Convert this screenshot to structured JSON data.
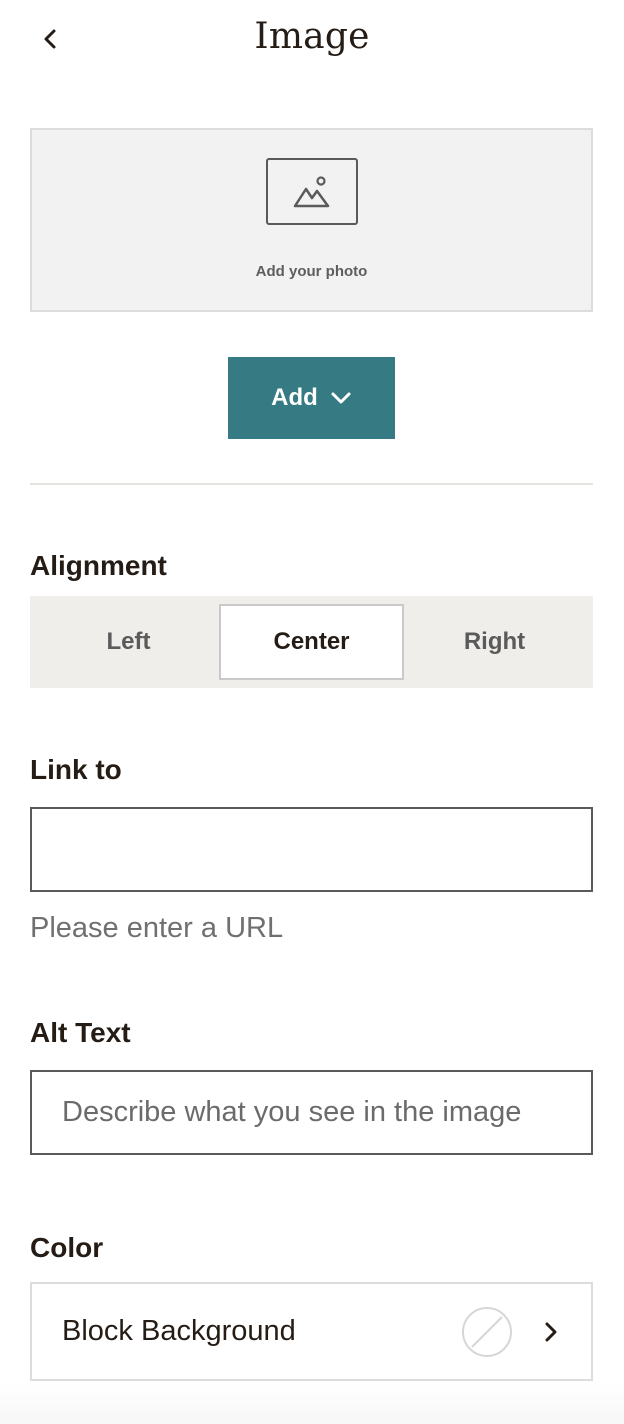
{
  "header": {
    "title": "Image",
    "back_icon": "chevron-left-icon"
  },
  "photo": {
    "icon": "image-icon",
    "label": "Add your photo"
  },
  "add_button": {
    "label": "Add",
    "icon": "chevron-down-icon"
  },
  "alignment": {
    "label": "Alignment",
    "options": [
      "Left",
      "Center",
      "Right"
    ],
    "selected": "Center"
  },
  "link": {
    "label": "Link to",
    "value": "",
    "helper": "Please enter a URL"
  },
  "alt_text": {
    "label": "Alt Text",
    "value": "",
    "placeholder": "Describe what you see in the image"
  },
  "color": {
    "label": "Color",
    "row_label": "Block Background",
    "swatch_icon": "no-color-swatch-icon",
    "chevron_icon": "chevron-right-icon"
  },
  "colors": {
    "accent": "#367b83",
    "text": "#241c15",
    "segment_bg": "#efeeea"
  }
}
